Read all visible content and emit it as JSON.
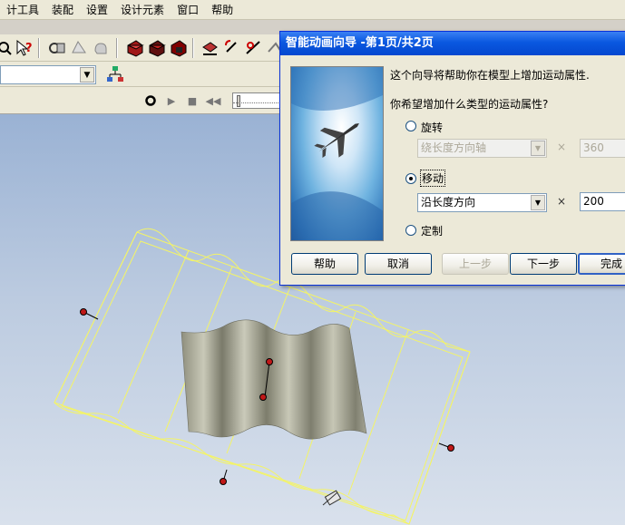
{
  "menu": [
    "计工具",
    "装配",
    "设置",
    "设计元素",
    "窗口",
    "帮助"
  ],
  "dialog": {
    "title": "智能动画向导 -第1页/共2页",
    "intro": "这个向导将帮助你在模型上增加运动属性.",
    "question": "你希望增加什么类型的运动属性?",
    "rotate": {
      "label": "旋转",
      "axis_value": "绕长度方向轴",
      "amount": "360",
      "selected": false
    },
    "move": {
      "label": "移动",
      "direction_value": "沿长度方向",
      "amount": "200",
      "selected": true
    },
    "custom": {
      "label": "定制",
      "selected": false
    },
    "times_symbol": "×",
    "buttons": {
      "help": "帮助",
      "cancel": "取消",
      "prev": "上一步",
      "next": "下一步",
      "finish": "完成"
    }
  },
  "colors": {
    "titlebar": "#0a58e0",
    "wireframe": "#f4f466",
    "surface": "#9a9a88",
    "viewport_top": "#9ab2d4",
    "handle": "#c01818"
  }
}
